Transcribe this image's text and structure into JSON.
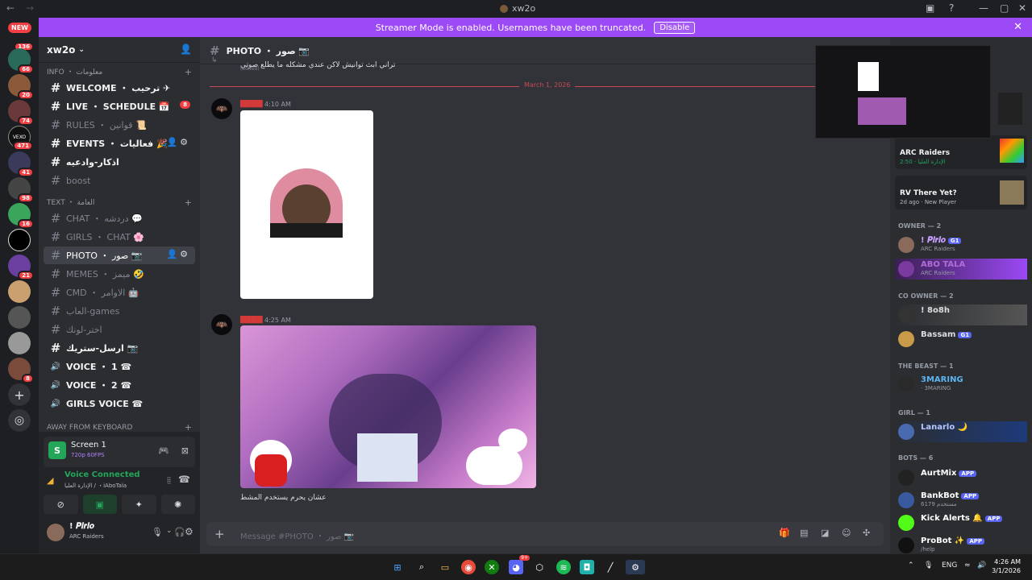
{
  "window": {
    "title": "xw2o",
    "back": "←",
    "forward": "→"
  },
  "banner": {
    "text": "Streamer Mode is enabled. Usernames have been truncated.",
    "button": "Disable"
  },
  "servers": {
    "new_label": "NEW",
    "badges": [
      "136",
      "66",
      "20",
      "74",
      "471",
      "41",
      "98",
      "16",
      "21",
      "8"
    ],
    "vexo_label": "VEXO",
    "add": "+",
    "explore": "◎"
  },
  "guild": {
    "name": "xw2o"
  },
  "categories": {
    "info": "INFO ・ معلومات",
    "text": "TEXT ・ العامة",
    "afk": "Away From Keyboard"
  },
  "channels": [
    {
      "name": "WELCOME ・ ترحيب ✈",
      "icon": "#",
      "bright": true
    },
    {
      "name": "LIVE ・ SCHEDULE 📅",
      "icon": "#",
      "bright": true,
      "badge": "8"
    },
    {
      "name": "RULES ・ قوانين 📜",
      "icon": "#"
    },
    {
      "name": "EVENTS ・ فعاليات 🎉",
      "icon": "#",
      "bright": true,
      "tools": true
    },
    {
      "name": "اذكار-وادعيه",
      "icon": "#",
      "bright": true
    },
    {
      "name": "boost",
      "icon": "#"
    },
    {
      "name": "CHAT ・ دردشه 💬",
      "icon": "#"
    },
    {
      "name": "GIRLS ・ CHAT 🌸",
      "icon": "#"
    },
    {
      "name": "PHOTO ・ صور 📷",
      "icon": "#",
      "active": true,
      "tools": true
    },
    {
      "name": "MEMES ・ ميمز 🤣",
      "icon": "#"
    },
    {
      "name": "CMD ・ الاوامر 🤖",
      "icon": "#"
    },
    {
      "name": "العاب-games",
      "icon": "#"
    },
    {
      "name": "اختر-لونك",
      "icon": "#"
    },
    {
      "name": "ارسل-ستريك 📷",
      "icon": "#",
      "bright": true
    },
    {
      "name": "VOICE ・ 1 ☎",
      "icon": "🔊",
      "bright": true
    },
    {
      "name": "VOICE ・ 2 ☎",
      "icon": "🔊",
      "bright": true
    },
    {
      "name": "GIRLS VOICE ☎",
      "icon": "🔊",
      "bright": true
    }
  ],
  "panel": {
    "screen_title": "Screen 1",
    "screen_sub": "720p 60FPS",
    "voice_status": "Voice Connected",
    "voice_channel": "الإدارة العليا / ・iAboTala",
    "user_name": "! 𝑷𝒊𝒓𝒍𝒐",
    "user_status": "ARC Raiders"
  },
  "chat": {
    "channel_title": "PHOTO ・ صور 📷",
    "top_message": "تراني ابث توانيش لاكن عندي مشكله ما يطلع صوتي",
    "edited": "(edited)",
    "date_divider": "March 1, 2026",
    "msg1_time": "4:10 AM",
    "msg2_time": "4:25 AM",
    "msg2_text": "عشان يحرم يستخدم المشط",
    "composer_placeholder": "Message #PHOTO ・ صور 📷"
  },
  "members": {
    "activities": [
      {
        "title": "ARC Raiders",
        "sub": "2:50 · الإدارة العليا"
      },
      {
        "title": "RV There Yet?",
        "sub": "2d ago · New Player"
      }
    ],
    "groups": [
      {
        "label": "OWNER — 2"
      },
      {
        "label": "CO OWNER — 2"
      },
      {
        "label": "THE BEAST — 1"
      },
      {
        "label": "GIRL — 1"
      },
      {
        "label": "BOTS — 6"
      }
    ],
    "list": [
      {
        "name": "! 𝑷𝒊𝒓𝒍𝒐",
        "status": "ARC Raiders",
        "color": "#c9a0ff",
        "tag": "G1"
      },
      {
        "name": "ABO TALA",
        "status": "ARC Raiders",
        "color": "#b06dd6"
      },
      {
        "name": "! 8o8h",
        "status": "",
        "color": "#dbdee1"
      },
      {
        "name": "Bassam",
        "status": "",
        "color": "#dbdee1",
        "tag": "G1"
      },
      {
        "name": "3MARING",
        "status": "· 3MARING",
        "color": "#5bb5f0"
      },
      {
        "name": "Lanarlo 🌙",
        "status": "",
        "color": "#b5c8ff"
      },
      {
        "name": "AurtMix",
        "status": "",
        "color": "#ffffff",
        "tag": "APP"
      },
      {
        "name": "BankBot",
        "status": "6179 مستخدم",
        "color": "#ffffff",
        "tag": "APP"
      },
      {
        "name": "Kick Alerts 🔔",
        "status": "",
        "color": "#ffffff",
        "tag": "APP"
      },
      {
        "name": "ProBot ✨",
        "status": "/help",
        "color": "#ffffff",
        "tag": "APP"
      }
    ]
  },
  "taskbar": {
    "lang": "ENG",
    "time": "4:26 AM",
    "date": "3/1/2026",
    "discord_badge": "9+"
  }
}
